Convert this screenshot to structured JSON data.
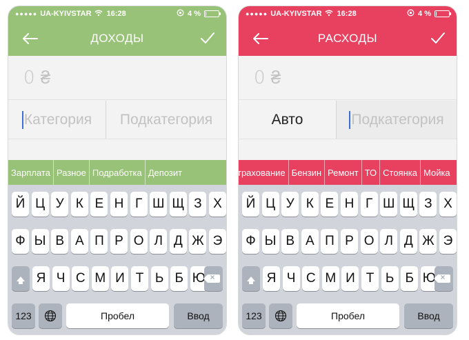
{
  "colors": {
    "income_accent": "#97c277",
    "expense_accent": "#e8405f"
  },
  "left": {
    "status": {
      "carrier": "UA-KYIVSTAR",
      "time": "16:28",
      "battery": "4 %",
      "battery_level": 0.04
    },
    "nav": {
      "title": "ДОХОДЫ",
      "back_icon": "arrow-left-icon",
      "done_icon": "checkmark-icon"
    },
    "amount": "0 ₴",
    "category": {
      "value": "Категория",
      "subcategory": "Подкатегория"
    },
    "suggestions": [
      "Зарплата",
      "Разное",
      "Подработка",
      "Депозит"
    ]
  },
  "right": {
    "status": {
      "carrier": "UA-KYIVSTAR",
      "time": "16:28",
      "battery": "4 %",
      "battery_level": 0.04
    },
    "nav": {
      "title": "РАСХОДЫ",
      "back_icon": "arrow-left-icon",
      "done_icon": "checkmark-icon"
    },
    "amount": "0 ₴",
    "category": {
      "value": "Авто",
      "subcategory": "Подкатегория"
    },
    "suggestions": [
      "трахование",
      "Бензин",
      "Ремонт",
      "ТО",
      "Стоянка",
      "Мойка"
    ]
  },
  "keyboard": {
    "row1": [
      "Й",
      "Ц",
      "У",
      "К",
      "Е",
      "Н",
      "Г",
      "Ш",
      "Щ",
      "З",
      "Х"
    ],
    "row2": [
      "Ф",
      "Ы",
      "В",
      "А",
      "П",
      "Р",
      "О",
      "Л",
      "Д",
      "Ж",
      "Э"
    ],
    "row3": [
      "Я",
      "Ч",
      "С",
      "М",
      "И",
      "Т",
      "Ь",
      "Б",
      "Ю"
    ],
    "numbers_label": "123",
    "space_label": "Пробел",
    "enter_label": "Ввод",
    "globe_icon": "globe-icon",
    "shift_icon": "shift-icon",
    "backspace_icon": "backspace-icon"
  }
}
